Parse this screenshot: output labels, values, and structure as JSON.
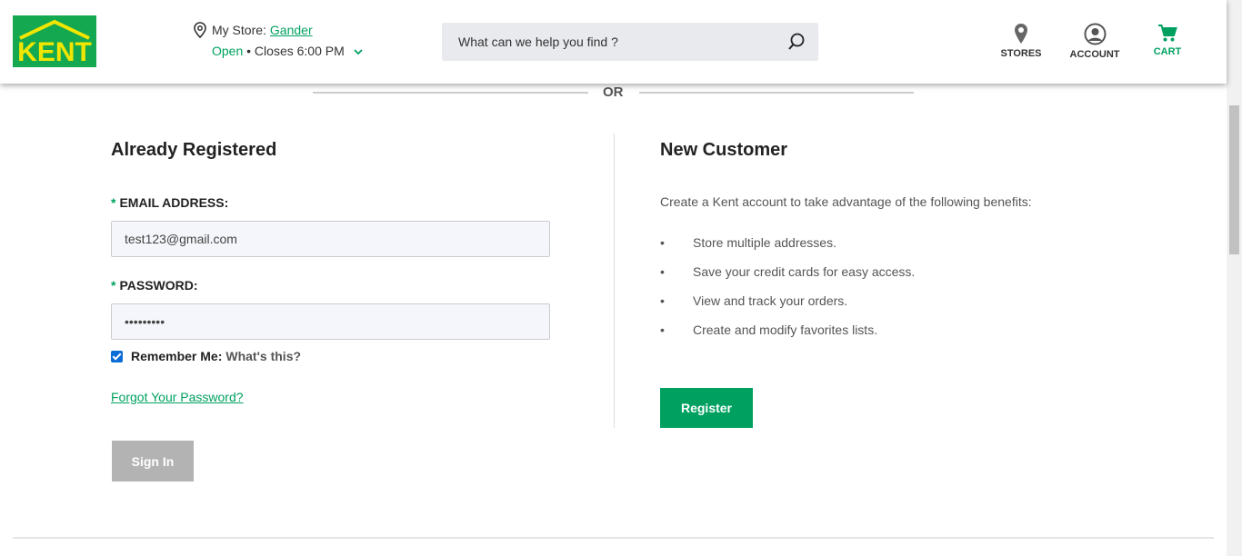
{
  "header": {
    "logo_text": "KENT",
    "store": {
      "prefix": "My Store:",
      "name": "Gander",
      "status": "Open",
      "hours": " • Closes 6:00 PM"
    },
    "search": {
      "placeholder": "What can we help you find ?"
    },
    "nav": {
      "stores": "STORES",
      "account": "ACCOUNT",
      "cart": "CART"
    }
  },
  "divider": {
    "or": "OR"
  },
  "login": {
    "title": "Already Registered",
    "email_label": "EMAIL ADDRESS:",
    "email_value": "test123@gmail.com",
    "password_label": "PASSWORD:",
    "password_value": "•••••••••",
    "required_mark": "*",
    "remember_label": "Remember Me:",
    "whats_this": "What's this?",
    "forgot": "Forgot Your Password?",
    "sign_in": "Sign In"
  },
  "register": {
    "title": "New Customer",
    "description": "Create a Kent account to take advantage of the following benefits:",
    "benefits": [
      "Store multiple addresses.",
      "Save your credit cards for easy access.",
      "View and track your orders.",
      "Create and modify favorites lists."
    ],
    "button": "Register"
  },
  "colors": {
    "accent": "#00a160",
    "logo_bg": "#14a850",
    "logo_fg": "#f2e600"
  }
}
